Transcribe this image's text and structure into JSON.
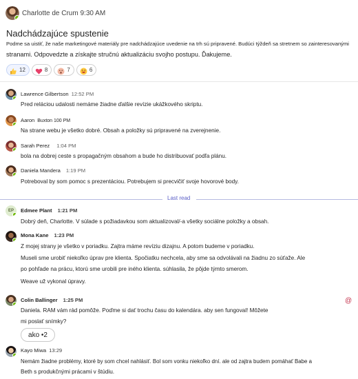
{
  "top_post": {
    "author": "Charlotte de Crum",
    "time": "9:30 AM",
    "title": "Nadchádzajúce spustenie",
    "line1": "Podme sa uistiť, že naše marketingové materiály pre nadchádzajúce uvedenie na trh sú pripravené. Budúci týždeň sa stretnem so zainteresovanými",
    "line2": "stranami. Odpovedzte a získajte stručnú aktualizáciu svojho postupu. Ďakujeme.",
    "reactions": [
      {
        "icon": "thumbs-up-icon",
        "count": "12"
      },
      {
        "icon": "heart-icon",
        "count": "8"
      },
      {
        "icon": "surprised-face-icon",
        "count": "7"
      },
      {
        "icon": "laughing-face-icon",
        "count": "6"
      }
    ]
  },
  "replies_before": [
    {
      "author": "Lawrence Gilbertson",
      "time": "12:52 PM",
      "lines": [
        "Pred reláciou udalosti nemáme žiadne ďalšie revízie ukážkového skriptu."
      ]
    },
    {
      "author": "Aaron",
      "time": "Buxton 100 PM",
      "lines": [
        "Na strane webu je všetko dobré. Obsah a položky sú pripravené na zverejnenie."
      ]
    },
    {
      "author": "Sarah Perez",
      "time": "1:04 PM",
      "lines": [
        "bola na dobrej ceste s propagačným obsahom a bude ho distribuovať podľa plánu."
      ]
    },
    {
      "author": "Daniela Mandera",
      "time": "1:19 PM",
      "lines": [
        "Potreboval by som pomoc s prezentáciou. Potrebujem si precvičiť svoje hovorové body."
      ]
    }
  ],
  "last_read_label": "Last read",
  "replies_after": [
    {
      "author": "Edmee Plant",
      "initials": "EP",
      "time": "1:21 PM",
      "lines": [
        "Dobrý deň, Charlotte. V súlade s požiadavkou som aktualizoval/-a všetky sociálne položky a obsah."
      ]
    },
    {
      "author": "Mona Kane",
      "time": "1:23 PM",
      "lines": [
        "Z mojej strany je všetko v poriadku. Zajtra máme revíziu dizajnu. A potom budeme v poriadku.",
        "Museli sme urobiť niekoľko úprav pre klienta. Spočiatku nechcela, aby sme sa odvolávali na žiadnu zo súťaže. Ale",
        "po pohľade na prácu, ktorú sme urobili pre iného klienta. súhlasila, že pôjde týmto smerom.",
        "Weave už vykonal úpravy."
      ]
    },
    {
      "author": "Colin Ballinger",
      "time": "1:25 PM",
      "lines": [
        "Daniela. RAM vám rád pomôže. Poďme si dať trochu času do kalendára. aby sen fungoval! Môžete",
        "mi poslať snímky?"
      ],
      "chip": "ako •2"
    },
    {
      "author": "Kayo Miwa",
      "time": "13:29",
      "lines": [
        "Nemám žiadne problémy, ktoré by som chcel nahlásiť. Bol som vonku niekoľko dní. ale od zajtra budem pomáhať Babe a",
        "Beth s produkčnými prácami v štúdiu."
      ]
    }
  ],
  "at_mention_symbol": "@",
  "colors": {
    "accent": "#5b5fc7",
    "presence": "#6bb700",
    "mention": "#c4314b"
  }
}
